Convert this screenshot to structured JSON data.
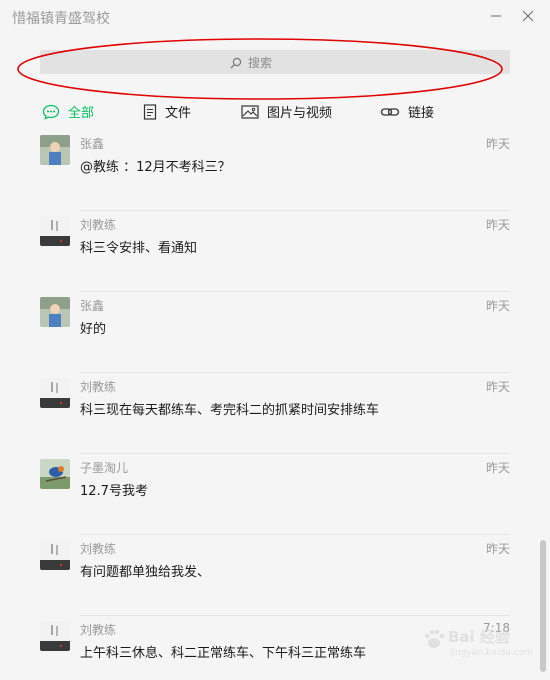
{
  "window": {
    "title": "惜福镇青盛驾校"
  },
  "search": {
    "placeholder": "搜索"
  },
  "tabs": [
    {
      "label": "全部",
      "icon": "chat-bubble-icon",
      "active": true
    },
    {
      "label": "文件",
      "icon": "document-icon",
      "active": false
    },
    {
      "label": "图片与视频",
      "icon": "image-icon",
      "active": false
    },
    {
      "label": "链接",
      "icon": "link-icon",
      "active": false
    }
  ],
  "messages": [
    {
      "sender": "张鑫",
      "time": "昨天",
      "text": "@教练 ：12月不考科三？",
      "avatar": "photo-avatar"
    },
    {
      "sender": "刘教练",
      "time": "昨天",
      "text": "科三令安排、看通知",
      "avatar": "calligraphy-avatar"
    },
    {
      "sender": "张鑫",
      "time": "昨天",
      "text": "好的",
      "avatar": "photo-avatar"
    },
    {
      "sender": "刘教练",
      "time": "昨天",
      "text": "科三现在每天都练车、考完科二的抓紧时间安排练车",
      "avatar": "calligraphy-avatar"
    },
    {
      "sender": "子墨淘儿",
      "time": "昨天",
      "text": "12.7号我考",
      "avatar": "bird-avatar"
    },
    {
      "sender": "刘教练",
      "time": "昨天",
      "text": "有问题都单独给我发、",
      "avatar": "calligraphy-avatar"
    },
    {
      "sender": "刘教练",
      "time": "7:18",
      "text": "上午科三休息、科二正常练车、下午科三正常练车",
      "avatar": "calligraphy-avatar"
    }
  ],
  "watermark": {
    "brand": "Bai 经验",
    "sub": "jingyan.baidu.com"
  },
  "colors": {
    "accent": "#07c160",
    "annotation": "#e00000"
  }
}
